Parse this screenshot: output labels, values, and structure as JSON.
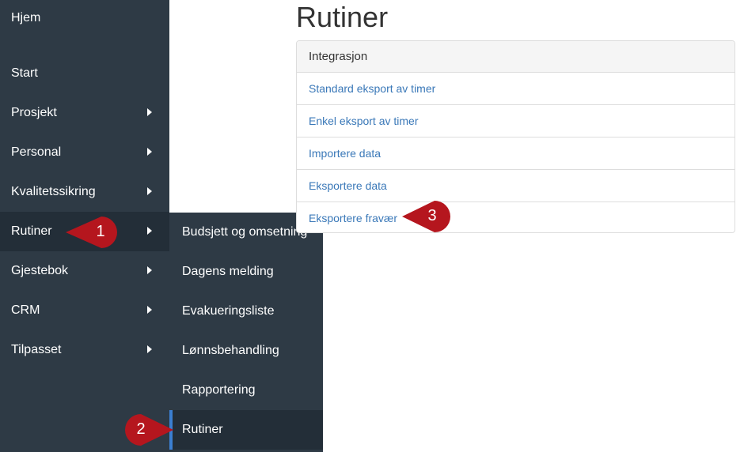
{
  "sidebar": {
    "items": [
      {
        "label": "Hjem"
      },
      {
        "label": "Start"
      },
      {
        "label": "Prosjekt"
      },
      {
        "label": "Personal"
      },
      {
        "label": "Kvalitetssikring"
      },
      {
        "label": "Rutiner"
      },
      {
        "label": "Gjestebok"
      },
      {
        "label": "CRM"
      },
      {
        "label": "Tilpasset"
      }
    ]
  },
  "submenu": {
    "items": [
      {
        "label": "Budsjett og omsetning"
      },
      {
        "label": "Dagens melding"
      },
      {
        "label": "Evakueringsliste"
      },
      {
        "label": "Lønnsbehandling"
      },
      {
        "label": "Rapportering"
      },
      {
        "label": "Rutiner"
      }
    ]
  },
  "main": {
    "title": "Rutiner",
    "panel": {
      "heading": "Integrasjon",
      "links": [
        {
          "label": "Standard eksport av timer"
        },
        {
          "label": "Enkel eksport av timer"
        },
        {
          "label": "Importere data"
        },
        {
          "label": "Eksportere data"
        },
        {
          "label": "Eksportere fravær"
        }
      ]
    }
  },
  "markers": [
    {
      "label": "1"
    },
    {
      "label": "2"
    },
    {
      "label": "3"
    }
  ],
  "colors": {
    "marker": "#b5161e",
    "accent": "#3b7fd1",
    "link": "#3a78b8",
    "sidebar": "#2e3a45"
  }
}
